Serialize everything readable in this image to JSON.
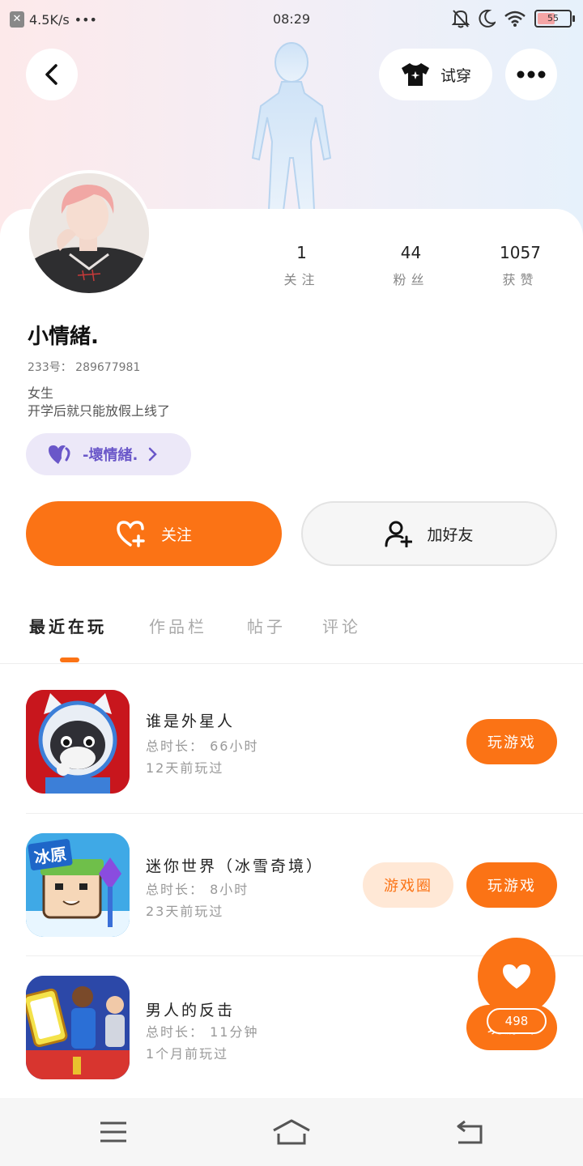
{
  "status_bar": {
    "speed": "4.5K/s",
    "dots": "•••",
    "time": "08:29",
    "battery": "55",
    "battery_level": 0.55
  },
  "header": {
    "try_on_label": "试穿"
  },
  "profile": {
    "nickname": "小情緒.",
    "uid": "233号： 289677981",
    "bio_line1": "女生",
    "bio_line2": "开学后就只能放假上线了",
    "guild_name": "-壞情緒."
  },
  "stats": [
    {
      "value": "1",
      "label": "关注"
    },
    {
      "value": "44",
      "label": "粉丝"
    },
    {
      "value": "1057",
      "label": "获赞"
    }
  ],
  "actions": {
    "follow_label": "关注",
    "add_friend_label": "加好友"
  },
  "tabs": [
    "最近在玩",
    "作品栏",
    "帖子",
    "评论"
  ],
  "games": [
    {
      "title": "谁是外星人",
      "duration": "总时长： 66小时",
      "last_played": "12天前玩过",
      "play_label": "玩游戏"
    },
    {
      "title": "迷你世界（冰雪奇境）",
      "duration": "总时长： 8小时",
      "last_played": "23天前玩过",
      "circle_label": "游戏圈",
      "play_label": "玩游戏",
      "icon_badge": "冰原"
    },
    {
      "title": "男人的反击",
      "duration": "总时长： 11分钟",
      "last_played": "1个月前玩过",
      "play_label": "玩游戏"
    }
  ],
  "like": {
    "count": "498"
  },
  "colors": {
    "accent": "#fb7315",
    "guild": "#6a57c9"
  }
}
